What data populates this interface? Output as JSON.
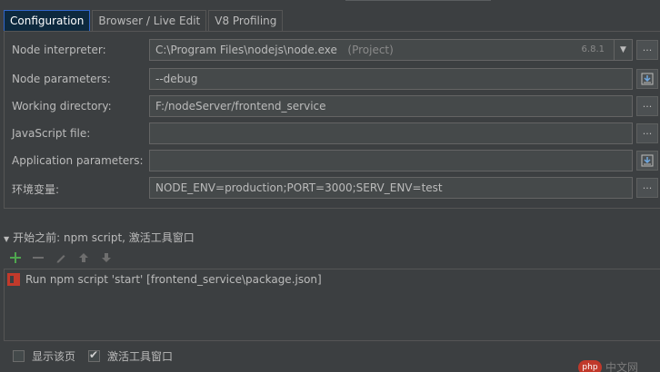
{
  "tabs": [
    {
      "label": "Configuration",
      "active": true
    },
    {
      "label": "Browser / Live Edit",
      "active": false
    },
    {
      "label": "V8 Profiling",
      "active": false
    }
  ],
  "form": {
    "node_interpreter": {
      "label": "Node interpreter:",
      "value": "C:\\Program Files\\nodejs\\node.exe",
      "hint": "(Project)",
      "version": "6.8.1",
      "browse": "..."
    },
    "node_parameters": {
      "label": "Node parameters:",
      "value": "--debug"
    },
    "working_directory": {
      "label": "Working directory:",
      "value": "F:/nodeServer/frontend_service",
      "browse": "..."
    },
    "javascript_file": {
      "label": "JavaScript file:",
      "value": "",
      "browse": "..."
    },
    "application_parameters": {
      "label": "Application parameters:",
      "value": ""
    },
    "env_vars": {
      "label": "环境变量:",
      "value": "NODE_ENV=production;PORT=3000;SERV_ENV=test",
      "browse": "..."
    }
  },
  "before_launch": {
    "header": "开始之前: npm script, 激活工具窗口",
    "items": [
      {
        "label": "Run npm script 'start' [frontend_service\\package.json]"
      }
    ]
  },
  "bottom": {
    "show_page": {
      "label": "显示该页",
      "checked": false
    },
    "activate_tool_window": {
      "label": "激活工具窗口",
      "checked": true
    }
  },
  "watermark": {
    "badge": "php",
    "text": "中文网"
  },
  "colors": {
    "accent_add": "#4fa64f",
    "tab_active_bg": "#0d293e",
    "tab_active_border": "#2f65ca",
    "npm_icon": "#c23a2b"
  }
}
